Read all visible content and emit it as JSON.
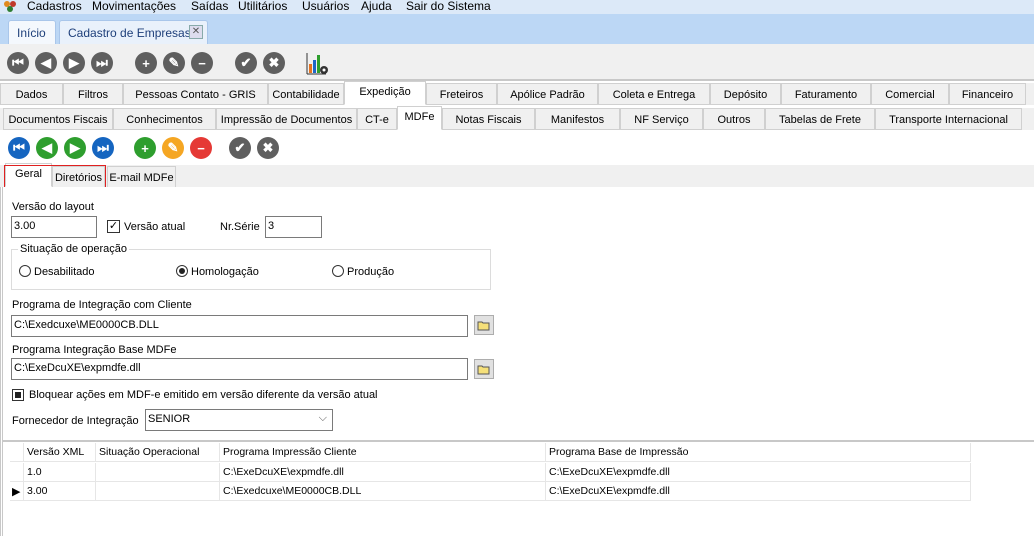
{
  "menu": {
    "items": [
      "Cadastros",
      "Movimentações",
      "Saídas",
      "Utilitários",
      "Usuários",
      "Ajuda",
      "Sair do Sistema"
    ]
  },
  "app_tabs": [
    {
      "label": "Início"
    },
    {
      "label": "Cadastro de Empresas",
      "closable": true
    }
  ],
  "main_tabs": [
    "Dados",
    "Filtros",
    "Pessoas Contato - GRIS",
    "Contabilidade",
    "Expedição",
    "Freteiros",
    "Apólice Padrão",
    "Coleta e Entrega",
    "Depósito",
    "Faturamento",
    "Comercial",
    "Financeiro"
  ],
  "main_tab_active": "Expedição",
  "sub_tabs": [
    "Documentos Fiscais",
    "Conhecimentos",
    "Impressão de Documentos",
    "CT-e",
    "MDFe",
    "Notas Fiscais",
    "Manifestos",
    "NF Serviço",
    "Outros",
    "Tabelas de Frete",
    "Transporte Internacional"
  ],
  "sub_tab_active": "MDFe",
  "mdfe_tabs": [
    "Geral",
    "Diretórios",
    "E-mail MDFe"
  ],
  "mdfe_tab_active": "Geral",
  "colors": {
    "nav_blue": "#1565c0",
    "nav_green": "#2e9e2e",
    "add_green": "#2e9e2e",
    "edit_orange": "#f5a623",
    "delete_red": "#e53935",
    "gray": "#5f5f5f",
    "highlight_red": "#e02020"
  },
  "form": {
    "layout_version_label": "Versão do layout",
    "layout_version_value": "3.00",
    "current_version_label": "Versão atual",
    "current_version_checked": true,
    "serie_label": "Nr.Série",
    "serie_value": "3",
    "operation_group_label": "Situação de operação",
    "operation_options": [
      "Desabilitado",
      "Homologação",
      "Produção"
    ],
    "operation_selected": "Homologação",
    "client_program_label": "Programa de Integração com Cliente",
    "client_program_value": "C:\\Exedcuxe\\ME0000CB.DLL",
    "base_program_label": "Programa Integração Base MDFe",
    "base_program_value": "C:\\ExeDcuXE\\expmdfe.dll",
    "block_label": "Bloquear ações em MDF-e emitido em versão diferente da versão atual",
    "block_checked": true,
    "supplier_label": "Fornecedor de Integração",
    "supplier_value": "SENIOR"
  },
  "grid": {
    "columns": [
      "Versão XML",
      "Situação Operacional",
      "Programa Impressão Cliente",
      "Programa Base de Impressão"
    ],
    "rows": [
      [
        "1.0",
        "",
        "C:\\ExeDcuXE\\expmdfe.dll",
        "C:\\ExeDcuXE\\expmdfe.dll"
      ],
      [
        "3.00",
        "",
        "C:\\Exedcuxe\\ME0000CB.DLL",
        "C:\\ExeDcuXE\\expmdfe.dll"
      ]
    ],
    "current_row": 1
  }
}
